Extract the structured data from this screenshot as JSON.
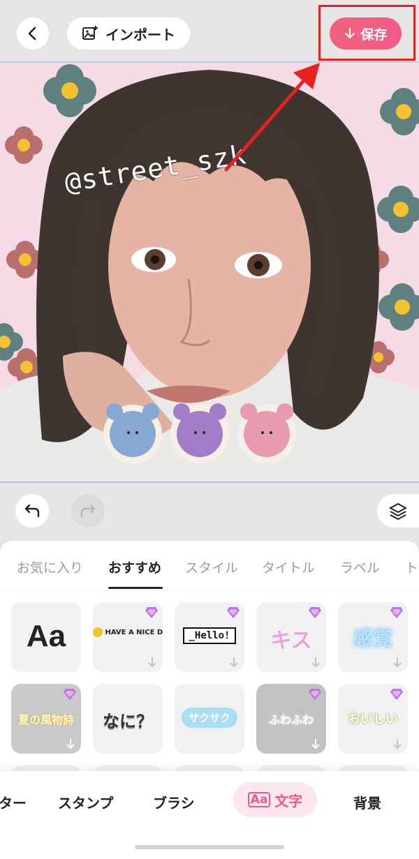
{
  "header": {
    "import_label": "インポート",
    "save_label": "保存"
  },
  "canvas": {
    "watermark_text": "@street_szk"
  },
  "category_tabs": [
    {
      "label": "お気に入り",
      "active": false
    },
    {
      "label": "おすすめ",
      "active": true
    },
    {
      "label": "スタイル",
      "active": false
    },
    {
      "label": "タイトル",
      "active": false
    },
    {
      "label": "ラベル",
      "active": false
    },
    {
      "label": "ト",
      "active": false
    }
  ],
  "text_presets": [
    {
      "text": "Aa",
      "premium": false
    },
    {
      "text": "HAVE A NICE DAY",
      "premium": true
    },
    {
      "text": "_Hello!",
      "premium": true
    },
    {
      "text": "キス",
      "premium": true
    },
    {
      "text": "感覚",
      "premium": true
    },
    {
      "text": "夏の風物詩",
      "premium": true
    },
    {
      "text": "なに？",
      "premium": false
    },
    {
      "text": "サクサク",
      "premium": false
    },
    {
      "text": "ふわふわ",
      "premium": true
    },
    {
      "text": "おいしい",
      "premium": true
    }
  ],
  "bottom_nav": {
    "items": [
      "ター",
      "スタンプ",
      "ブラシ",
      "文字",
      "背景"
    ],
    "active_badge": "Aa",
    "active_index": 3
  },
  "colors": {
    "accent": "#f0588a",
    "save_gradient_start": "#f0627a",
    "highlight_frame": "#e8201f",
    "canvas_bg": "#f4dbe5"
  }
}
